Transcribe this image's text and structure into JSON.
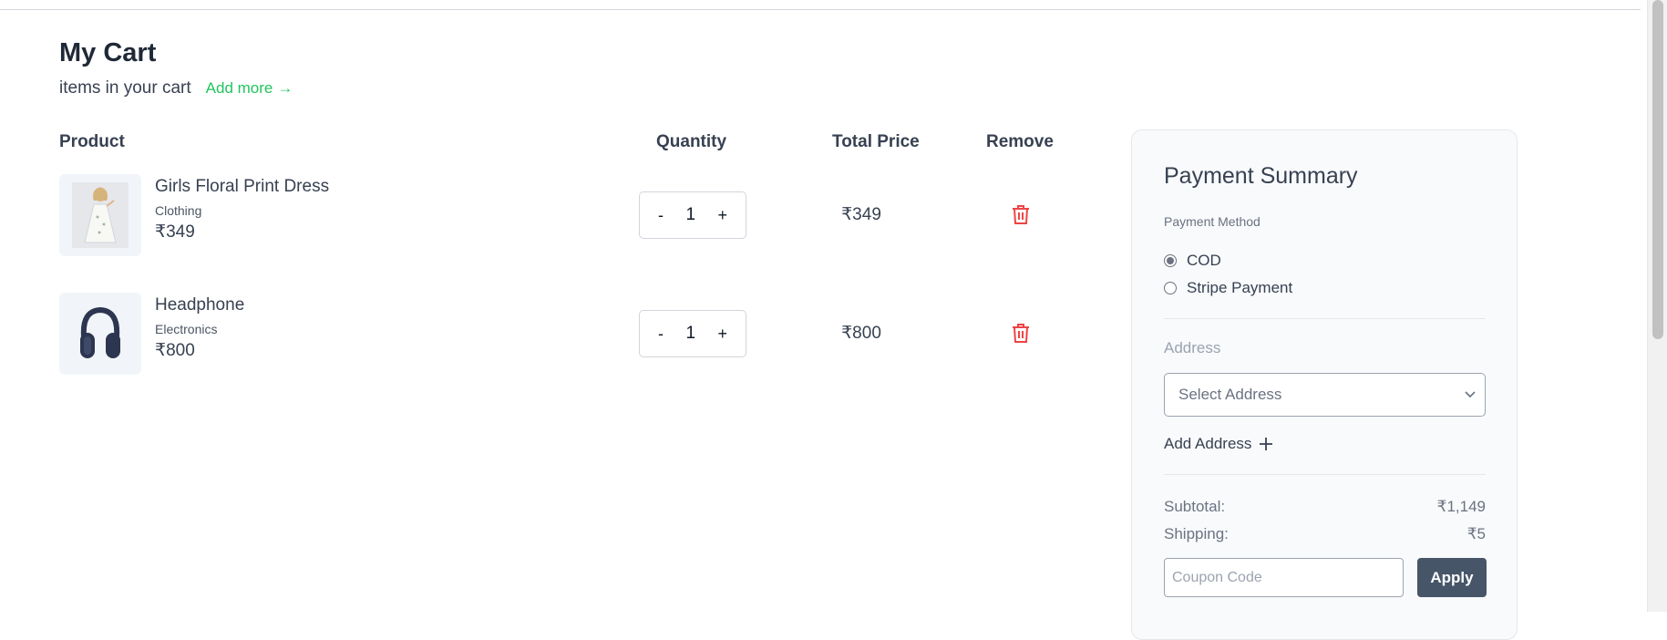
{
  "page": {
    "title": "My Cart",
    "subtitle": "items in your cart",
    "add_more_label": "Add more",
    "add_more_arrow": "→"
  },
  "table": {
    "headers": {
      "product": "Product",
      "quantity": "Quantity",
      "total": "Total Price",
      "remove": "Remove"
    },
    "items": [
      {
        "name": "Girls Floral Print Dress",
        "category": "Clothing",
        "price": "₹349",
        "quantity": "1",
        "total": "₹349",
        "image_icon": "dress-image",
        "minus": "-",
        "plus": "+"
      },
      {
        "name": "Headphone",
        "category": "Electronics",
        "price": "₹800",
        "quantity": "1",
        "total": "₹800",
        "image_icon": "headphone-image",
        "minus": "-",
        "plus": "+"
      }
    ]
  },
  "summary": {
    "title": "Payment Summary",
    "payment_method_label": "Payment Method",
    "payment_options": [
      {
        "label": "COD",
        "selected": true
      },
      {
        "label": "Stripe Payment",
        "selected": false
      }
    ],
    "address_label": "Address",
    "address_select_placeholder": "Select Address",
    "add_address_label": "Add Address",
    "subtotal_label": "Subtotal:",
    "subtotal_value": "₹1,149",
    "shipping_label": "Shipping:",
    "shipping_value": "₹5",
    "coupon_placeholder": "Coupon Code",
    "apply_label": "Apply"
  },
  "colors": {
    "accent_green": "#22c55e",
    "delete_red": "#ef4444",
    "button_dark": "#475569"
  }
}
